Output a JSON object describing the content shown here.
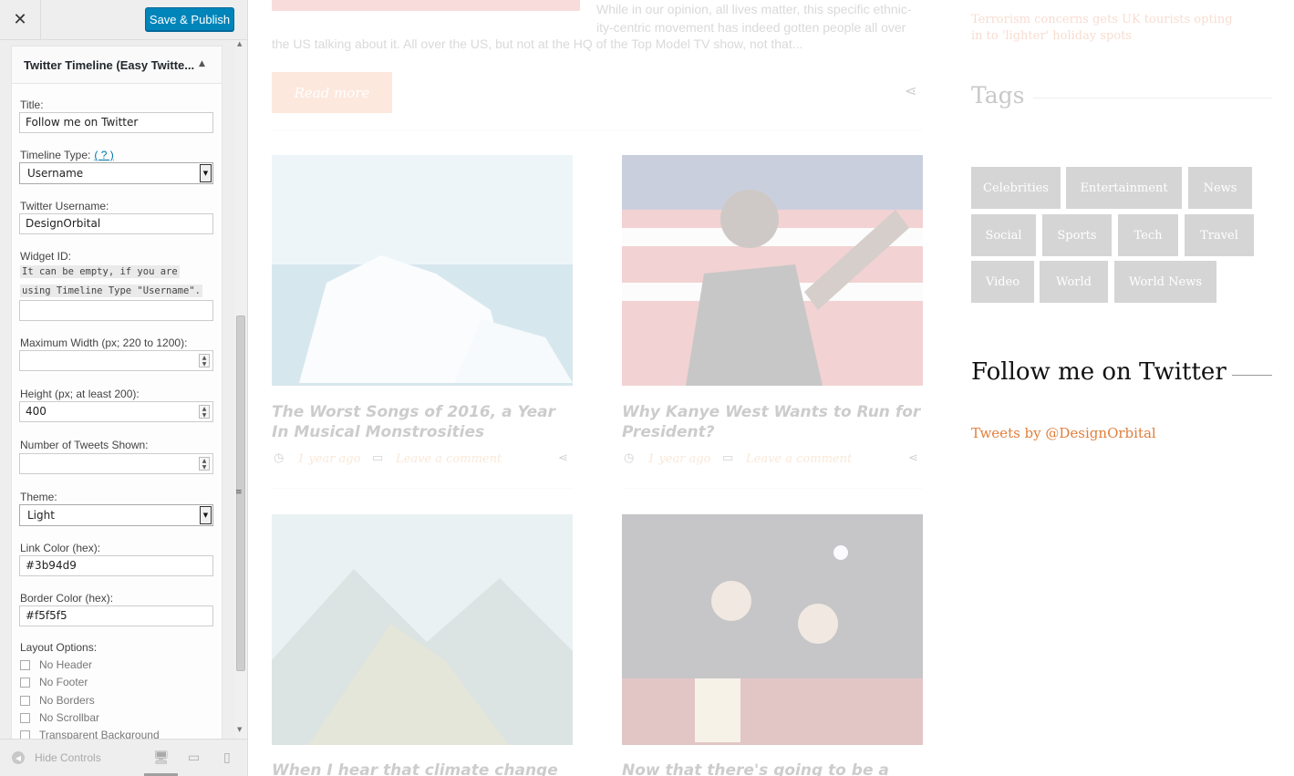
{
  "customizer": {
    "close_icon": "close-icon",
    "publish_label": "Save & Publish",
    "widget_title": "Twitter Timeline (Easy Twitte...",
    "fields": {
      "title_label": "Title:",
      "title_value": "Follow me on Twitter",
      "timeline_type_label": "Timeline Type:",
      "timeline_type_help": "( ? )",
      "timeline_type_value": "Username",
      "username_label": "Twitter Username:",
      "username_value": "DesignOrbital",
      "widget_id_label": "Widget ID:",
      "widget_id_hint_1": "It can be empty, if you are",
      "widget_id_hint_2": "using Timeline Type \"Username\".",
      "widget_id_value": "",
      "max_width_label": "Maximum Width (px; 220 to 1200):",
      "max_width_value": "",
      "height_label": "Height (px; at least 200):",
      "height_value": "400",
      "tweets_label": "Number of Tweets Shown:",
      "tweets_value": "",
      "theme_label": "Theme:",
      "theme_value": "Light",
      "link_color_label": "Link Color (hex):",
      "link_color_value": "#3b94d9",
      "border_color_label": "Border Color (hex):",
      "border_color_value": "#f5f5f5",
      "layout_options_label": "Layout Options:"
    },
    "layout_options": [
      "No Header",
      "No Footer",
      "No Borders",
      "No Scrollbar",
      "Transparent Background"
    ],
    "footer": {
      "hide_controls_label": "Hide Controls",
      "devices": [
        "desktop-icon",
        "tablet-icon",
        "mobile-icon"
      ]
    },
    "colors": {
      "publish": "#0085ba",
      "panel_bg": "#eeeeee",
      "help_link": "#0073aa"
    }
  },
  "preview": {
    "excerpt_line1": "While in our opinion, all lives matter, this specific ethnic-",
    "excerpt_line2": "ity-centric movement has indeed gotten people all over",
    "excerpt_line3": "the US talking about it. All over the US, but not at the HQ of the Top Model TV show, not that...",
    "read_more": "Read more",
    "posts": [
      {
        "title": "The Worst Songs of 2016, a Year In Musical Monstrosities",
        "time": "1 year ago",
        "comment": "Leave a comment"
      },
      {
        "title": "Why Kanye West Wants to Run for President?",
        "time": "1 year ago",
        "comment": "Leave a comment"
      },
      {
        "title": "When I hear that climate change is a",
        "time": "",
        "comment": ""
      },
      {
        "title": "Now that there's going to be a new",
        "time": "",
        "comment": ""
      }
    ],
    "sidebar": {
      "trend_link": "Terrorism concerns gets UK tourists opting in to 'lighter' holiday spots",
      "tags_heading": "Tags",
      "tags": [
        "Celebrities",
        "Entertainment",
        "News",
        "Social",
        "Sports",
        "Tech",
        "Travel",
        "Video",
        "World",
        "World News"
      ],
      "follow_heading": "Follow me on Twitter",
      "tweets_link": "Tweets by @DesignOrbital"
    },
    "colors": {
      "accent": "#e07e3a",
      "tag_bg": "#555555",
      "read_more_bg": "#f5a078"
    }
  }
}
